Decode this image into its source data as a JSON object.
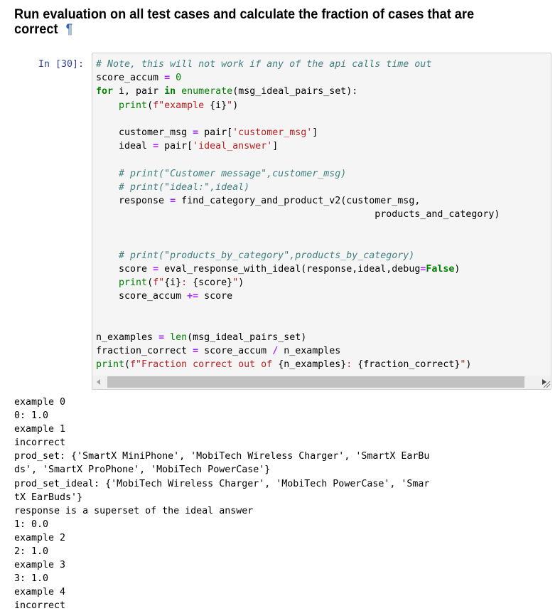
{
  "heading": {
    "text": "Run evaluation on all test cases and calculate the fraction of cases that are correct",
    "anchor_symbol": "¶"
  },
  "cell": {
    "prompt": "In [30]:",
    "code_lines": [
      [
        {
          "t": "cm",
          "v": "# Note, this will not work if any of the api calls time out"
        }
      ],
      [
        {
          "t": "",
          "v": "score_accum "
        },
        {
          "t": "op",
          "v": "="
        },
        {
          "t": "",
          "v": " "
        },
        {
          "t": "bi",
          "v": "0"
        }
      ],
      [
        {
          "t": "kw",
          "v": "for"
        },
        {
          "t": "",
          "v": " i, pair "
        },
        {
          "t": "kw",
          "v": "in"
        },
        {
          "t": "",
          "v": " "
        },
        {
          "t": "bi",
          "v": "enumerate"
        },
        {
          "t": "",
          "v": "(msg_ideal_pairs_set):"
        }
      ],
      [
        {
          "t": "",
          "v": "    "
        },
        {
          "t": "bi",
          "v": "print"
        },
        {
          "t": "",
          "v": "("
        },
        {
          "t": "sa",
          "v": "f\"example "
        },
        {
          "t": "",
          "v": "{i}"
        },
        {
          "t": "sa",
          "v": "\""
        },
        {
          "t": "",
          "v": ")"
        }
      ],
      [
        {
          "t": "",
          "v": ""
        }
      ],
      [
        {
          "t": "",
          "v": "    customer_msg "
        },
        {
          "t": "op",
          "v": "="
        },
        {
          "t": "",
          "v": " pair["
        },
        {
          "t": "st",
          "v": "'customer_msg'"
        },
        {
          "t": "",
          "v": "]"
        }
      ],
      [
        {
          "t": "",
          "v": "    ideal "
        },
        {
          "t": "op",
          "v": "="
        },
        {
          "t": "",
          "v": " pair["
        },
        {
          "t": "st",
          "v": "'ideal_answer'"
        },
        {
          "t": "",
          "v": "]"
        }
      ],
      [
        {
          "t": "",
          "v": ""
        }
      ],
      [
        {
          "t": "",
          "v": "    "
        },
        {
          "t": "cm",
          "v": "# print(\"Customer message\",customer_msg)"
        }
      ],
      [
        {
          "t": "",
          "v": "    "
        },
        {
          "t": "cm",
          "v": "# print(\"ideal:\",ideal)"
        }
      ],
      [
        {
          "t": "",
          "v": "    response "
        },
        {
          "t": "op",
          "v": "="
        },
        {
          "t": "",
          "v": " find_category_and_product_v2(customer_msg,"
        }
      ],
      [
        {
          "t": "",
          "v": "                                                 products_and_category)"
        }
      ],
      [
        {
          "t": "",
          "v": ""
        }
      ],
      [
        {
          "t": "",
          "v": ""
        }
      ],
      [
        {
          "t": "",
          "v": "    "
        },
        {
          "t": "cm",
          "v": "# print(\"products_by_category\",products_by_category)"
        }
      ],
      [
        {
          "t": "",
          "v": "    score "
        },
        {
          "t": "op",
          "v": "="
        },
        {
          "t": "",
          "v": " eval_response_with_ideal(response,ideal,debug"
        },
        {
          "t": "op",
          "v": "="
        },
        {
          "t": "kw",
          "v": "False"
        },
        {
          "t": "",
          "v": ")"
        }
      ],
      [
        {
          "t": "",
          "v": "    "
        },
        {
          "t": "bi",
          "v": "print"
        },
        {
          "t": "",
          "v": "("
        },
        {
          "t": "sa",
          "v": "f\""
        },
        {
          "t": "",
          "v": "{i}"
        },
        {
          "t": "sa",
          "v": ": "
        },
        {
          "t": "",
          "v": "{score}"
        },
        {
          "t": "sa",
          "v": "\""
        },
        {
          "t": "",
          "v": ")"
        }
      ],
      [
        {
          "t": "",
          "v": "    score_accum "
        },
        {
          "t": "op",
          "v": "+="
        },
        {
          "t": "",
          "v": " score"
        }
      ],
      [
        {
          "t": "",
          "v": ""
        }
      ],
      [
        {
          "t": "",
          "v": ""
        }
      ],
      [
        {
          "t": "",
          "v": "n_examples "
        },
        {
          "t": "op",
          "v": "="
        },
        {
          "t": "",
          "v": " "
        },
        {
          "t": "bi",
          "v": "len"
        },
        {
          "t": "",
          "v": "(msg_ideal_pairs_set)"
        }
      ],
      [
        {
          "t": "",
          "v": "fraction_correct "
        },
        {
          "t": "op",
          "v": "="
        },
        {
          "t": "",
          "v": " score_accum "
        },
        {
          "t": "op",
          "v": "/"
        },
        {
          "t": "",
          "v": " n_examples"
        }
      ],
      [
        {
          "t": "bi",
          "v": "print"
        },
        {
          "t": "",
          "v": "("
        },
        {
          "t": "sa",
          "v": "f\"Fraction correct out of "
        },
        {
          "t": "",
          "v": "{n_examples}"
        },
        {
          "t": "sa",
          "v": ": "
        },
        {
          "t": "",
          "v": "{fraction_correct}"
        },
        {
          "t": "sa",
          "v": "\""
        },
        {
          "t": "",
          "v": ")"
        }
      ]
    ]
  },
  "output_lines": [
    "example 0",
    "0: 1.0",
    "example 1",
    "incorrect",
    "prod_set: {'SmartX MiniPhone', 'MobiTech Wireless Charger', 'SmartX EarBu",
    "ds', 'SmartX ProPhone', 'MobiTech PowerCase'}",
    "prod_set_ideal: {'MobiTech Wireless Charger', 'MobiTech PowerCase', 'Smar",
    "tX EarBuds'}",
    "response is a superset of the ideal answer",
    "1: 0.0",
    "example 2",
    "2: 1.0",
    "example 3",
    "3: 1.0",
    "example 4",
    "incorrect"
  ]
}
